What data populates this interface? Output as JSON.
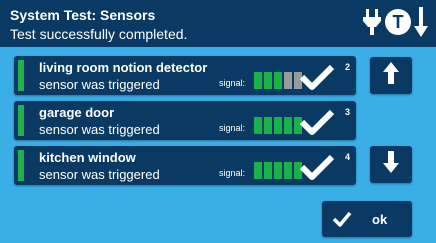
{
  "header": {
    "title": "System Test: Sensors",
    "subtitle": "Test successfully completed.",
    "icons": [
      "plug-icon",
      "t-badge-icon",
      "down-arrow-icon"
    ],
    "t_badge_text": "T"
  },
  "signal_label": "signal:",
  "sensors": [
    {
      "name": "living room notion detector",
      "status": "sensor was triggered",
      "signal_level": 3,
      "signal_max": 5,
      "number": "2"
    },
    {
      "name": "garage door",
      "status": "sensor was triggered",
      "signal_level": 5,
      "signal_max": 5,
      "number": "3"
    },
    {
      "name": "kitchen window",
      "status": "sensor was triggered",
      "signal_level": 5,
      "signal_max": 5,
      "number": "4"
    }
  ],
  "nav": {
    "up_icon": "up-arrow-icon",
    "down_icon": "down-arrow-icon"
  },
  "ok_button": {
    "label": "ok",
    "icon": "check-icon"
  },
  "colors": {
    "background": "#3aaee6",
    "panel": "#0a3a63",
    "signal_on": "#18b24a",
    "signal_off": "#9a9a9a",
    "indicator": "#22b24c"
  }
}
